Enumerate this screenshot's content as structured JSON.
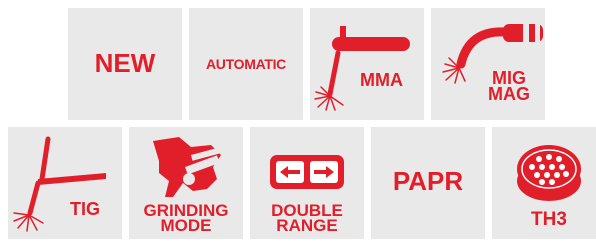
{
  "colors": {
    "accent": "#e01f2b",
    "tile": "#e9e9e9",
    "background": "#ffffff"
  },
  "row1": [
    {
      "id": "new",
      "label": "NEW",
      "icon": "none"
    },
    {
      "id": "automatic",
      "label": "AUTOMATIC",
      "icon": "none"
    },
    {
      "id": "mma",
      "label": "MMA",
      "icon": "mma-torch-icon"
    },
    {
      "id": "mig-mag",
      "label": "MIG\nMAG",
      "icon": "mig-torch-icon"
    }
  ],
  "row2": [
    {
      "id": "tig",
      "label": "TIG",
      "icon": "tig-torch-icon"
    },
    {
      "id": "grinding-mode",
      "label": "GRINDING\nMODE",
      "icon": "grinder-icon"
    },
    {
      "id": "double-range",
      "label": "DOUBLE\nRANGE",
      "icon": "double-arrow-icon"
    },
    {
      "id": "papr",
      "label": "PAPR",
      "icon": "none"
    },
    {
      "id": "th3",
      "label": "TH3",
      "icon": "filter-icon"
    }
  ]
}
